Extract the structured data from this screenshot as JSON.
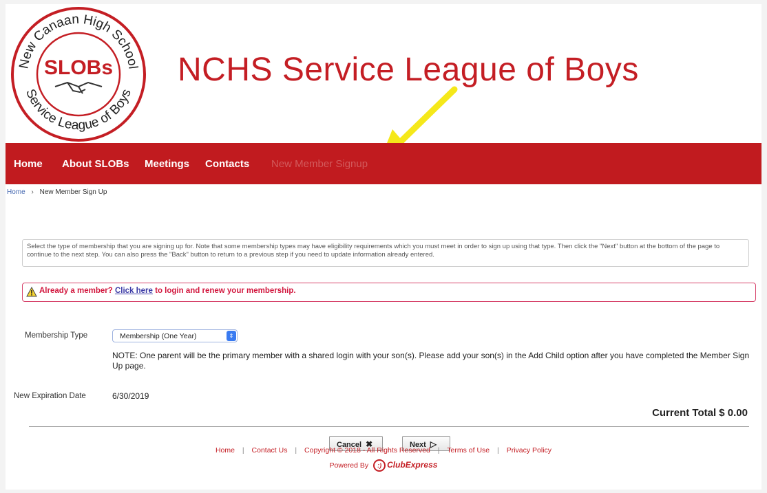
{
  "header": {
    "logo": {
      "ring_text_top": "New Canaan High School",
      "ring_text_bottom": "Service League of Boys",
      "center_text": "SLOBs",
      "icon": "handshake-icon"
    },
    "site_title": "NCHS Service League of Boys",
    "annotation_arrow": {
      "color": "#f5e81a",
      "icon": "arrow-icon"
    }
  },
  "nav": {
    "items": [
      {
        "label": "Home"
      },
      {
        "label": "About SLOBs"
      },
      {
        "label": "Meetings"
      },
      {
        "label": "Contacts"
      },
      {
        "label": "New Member Signup"
      }
    ],
    "background": "#c11b1f"
  },
  "breadcrumb": {
    "home": "Home",
    "separator": "›",
    "current": "New Member Sign Up"
  },
  "instructions": "Select the type of membership that you are signing up for. Note that some membership types may have eligibility requirements which you must meet in order to sign up using that type. Then click the \"Next\" button at the bottom of the page to continue to the next step. You can also press the \"Back\" button to return to a previous step if you need to update information already entered.",
  "alert": {
    "icon": "warning-icon",
    "prefix": "Already a member? ",
    "link": "Click here",
    "suffix": " to login and renew your membership."
  },
  "form": {
    "membership_type_label": "Membership Type",
    "membership_type_value": "Membership (One Year)",
    "note": "NOTE: One parent will be the primary member with a shared login with your son(s). Please add your son(s) in the Add Child option after you have completed the Member Sign Up page.",
    "expiration_label": "New Expiration Date",
    "expiration_value": "6/30/2019",
    "total": "Current Total $ 0.00"
  },
  "buttons": {
    "cancel": "Cancel",
    "next": "Next"
  },
  "footer": {
    "links": [
      "Home",
      "Contact Us",
      "Terms of Use",
      "Privacy Policy"
    ],
    "copyright": "Copyright © 2018 - All Rights Reserved",
    "powered_by": "Powered By",
    "powered_brand": "ClubExpress"
  },
  "colors": {
    "brand_red": "#c41e24",
    "alert_red": "#d2173e",
    "link_blue": "#3b3aa6"
  }
}
